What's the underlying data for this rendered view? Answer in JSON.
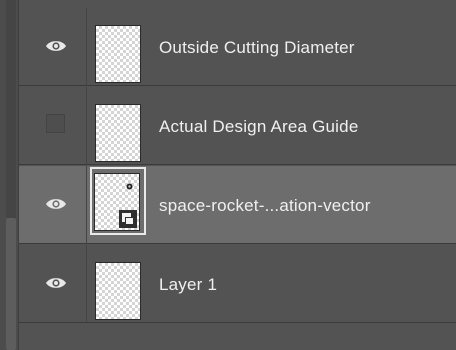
{
  "panel": {
    "layers": [
      {
        "name": "Outside Cutting Diameter",
        "visible": true,
        "selected": false,
        "visibility_icon": "eye-icon"
      },
      {
        "name": "Actual Design Area Guide",
        "visible": false,
        "selected": false,
        "visibility_icon": "empty-visibility-box"
      },
      {
        "name": "space-rocket-...ation-vector",
        "visible": true,
        "selected": true,
        "visibility_icon": "eye-icon",
        "type_icon": "smart-object-icon"
      },
      {
        "name": "Layer 1",
        "visible": true,
        "selected": false,
        "visibility_icon": "eye-icon"
      }
    ]
  },
  "colors": {
    "panel_bg": "#535353",
    "selected_row_bg": "#6d6d6d",
    "text": "#f0f0f0"
  }
}
